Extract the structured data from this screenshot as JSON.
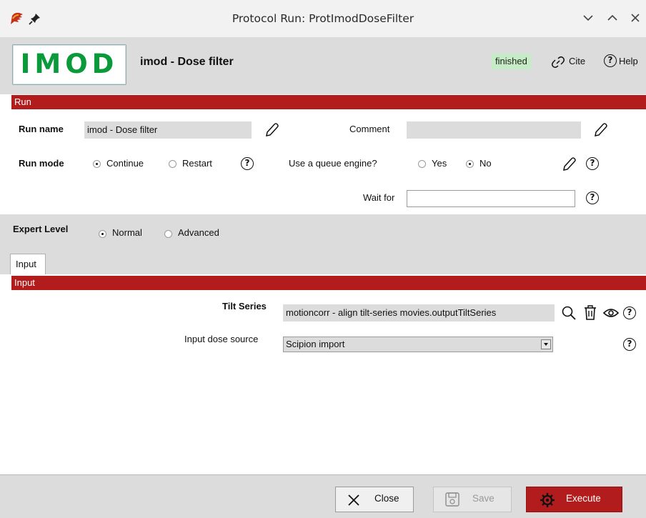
{
  "window": {
    "title": "Protocol Run: ProtImodDoseFilter",
    "icons": [
      "scipion-logo-icon",
      "pin-icon",
      "minimize-icon",
      "maximize-icon",
      "close-icon"
    ]
  },
  "header": {
    "logo_text": "IMOD",
    "protocol_title": "imod - Dose filter",
    "status": "finished",
    "cite_label": "Cite",
    "help_label": "Help",
    "status_color": "#c5ecc4"
  },
  "run_section": {
    "title": "Run",
    "run_name_label": "Run name",
    "run_name_value": "imod - Dose filter",
    "comment_label": "Comment",
    "comment_value": "",
    "run_mode_label": "Run mode",
    "run_mode_options": [
      "Continue",
      "Restart"
    ],
    "run_mode_selected": "Continue",
    "queue_label": "Use a queue engine?",
    "queue_options": [
      "Yes",
      "No"
    ],
    "queue_selected": "No",
    "wait_for_label": "Wait for",
    "wait_for_value": ""
  },
  "expert": {
    "label": "Expert Level",
    "options": [
      "Normal",
      "Advanced"
    ],
    "selected": "Normal"
  },
  "tabs": [
    {
      "label": "Input",
      "active": true
    }
  ],
  "input_section": {
    "title": "Input",
    "tilt_series_label": "Tilt Series",
    "tilt_series_value": "motioncorr - align tilt-series movies.outputTiltSeries",
    "dose_source_label": "Input dose source",
    "dose_source_value": "Scipion import"
  },
  "footer": {
    "close_label": "Close",
    "save_label": "Save",
    "execute_label": "Execute"
  },
  "colors": {
    "section_bar": "#b21c1c",
    "logo_green": "#0a9a3a",
    "execute_button": "#b21c1c",
    "panel_grey": "#dcdcdc"
  }
}
